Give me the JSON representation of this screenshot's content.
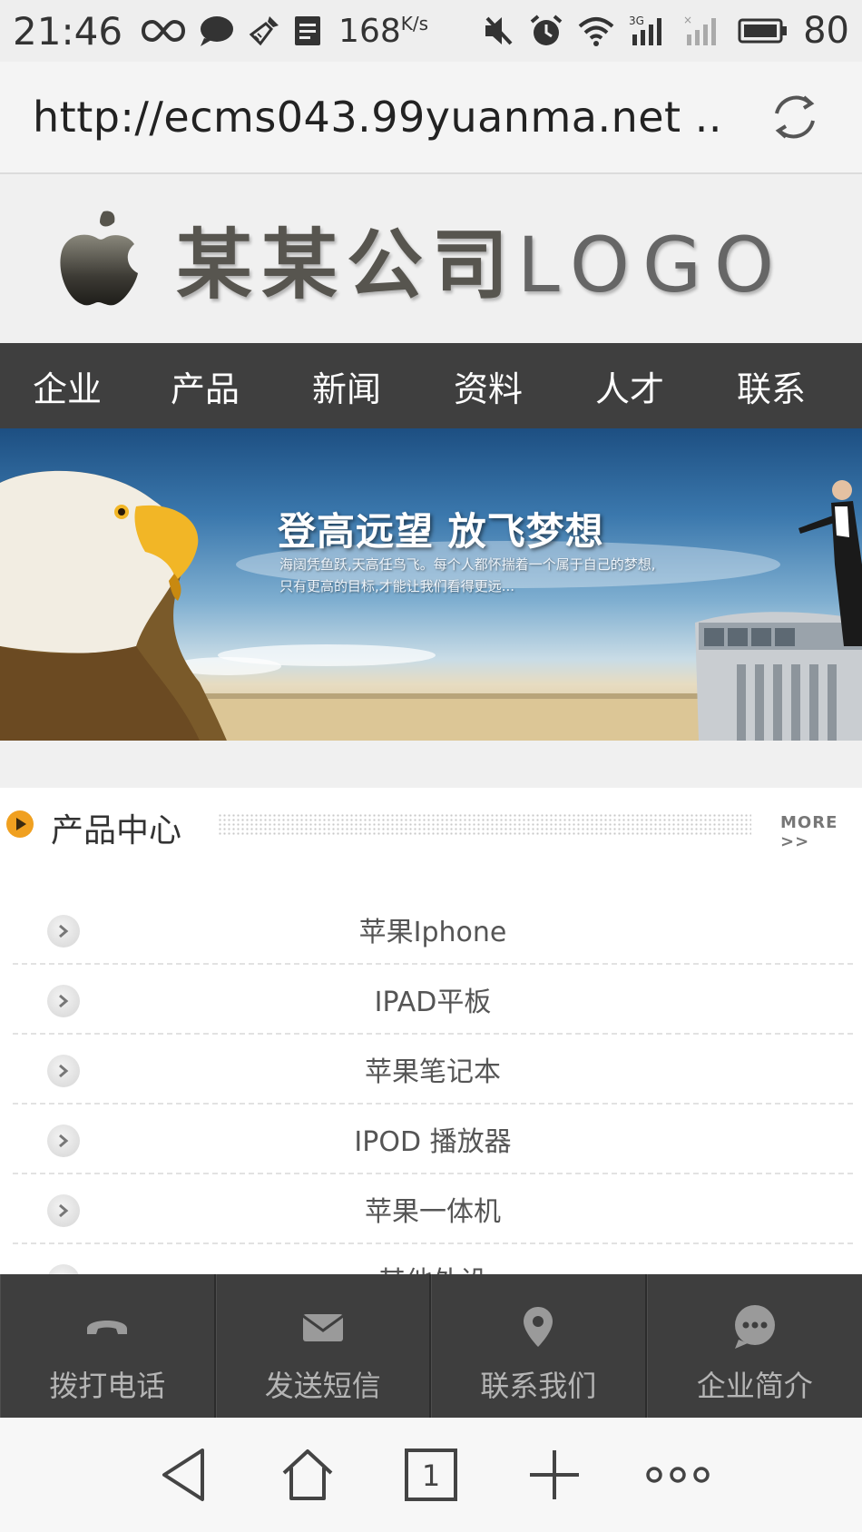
{
  "status_bar": {
    "time": "21:46",
    "speed": "168",
    "speed_unit": "K/s",
    "network": "3G",
    "battery": "80",
    "icons": [
      "infinity-icon",
      "chat-bubble-icon",
      "cleaner-icon",
      "document-icon",
      "mute-icon",
      "alarm-icon",
      "wifi-icon",
      "signal-3g-icon",
      "signal-no-service-icon",
      "battery-icon"
    ]
  },
  "url_bar": {
    "url": "http://ecms043.99yuanma.net ..",
    "reload_icon": "reload-icon"
  },
  "header": {
    "logo_cn": "某某公司",
    "logo_en": "LOGO"
  },
  "nav": {
    "items": [
      "企业",
      "产品",
      "新闻",
      "资料",
      "人才",
      "联系"
    ]
  },
  "banner": {
    "headline": "登高远望 放飞梦想",
    "subtext": "海阔凭鱼跃,天高任鸟飞。每个人都怀揣着一个属于自己的梦想,只有更高的目标,才能让我们看得更远..."
  },
  "products": {
    "title": "产品中心",
    "more": "MORE >>",
    "items": [
      "苹果Iphone",
      "IPAD平板",
      "苹果笔记本",
      "IPOD 播放器",
      "苹果一体机",
      "其他外设"
    ]
  },
  "toolbar": {
    "items": [
      {
        "label": "拨打电话",
        "icon": "phone-icon"
      },
      {
        "label": "发送短信",
        "icon": "envelope-icon"
      },
      {
        "label": "联系我们",
        "icon": "location-pin-icon"
      },
      {
        "label": "企业简介",
        "icon": "chat-dots-icon"
      }
    ]
  },
  "browser_nav": {
    "tab_count": "1",
    "icons": [
      "back-icon",
      "home-icon",
      "tabs-icon",
      "add-icon",
      "more-icon"
    ]
  },
  "colors": {
    "nav_bg": "#3f3f3f",
    "toolbar_bg": "#3e3e3e",
    "accent_orange": "#f0a020",
    "page_bg": "#f0f0f0"
  }
}
